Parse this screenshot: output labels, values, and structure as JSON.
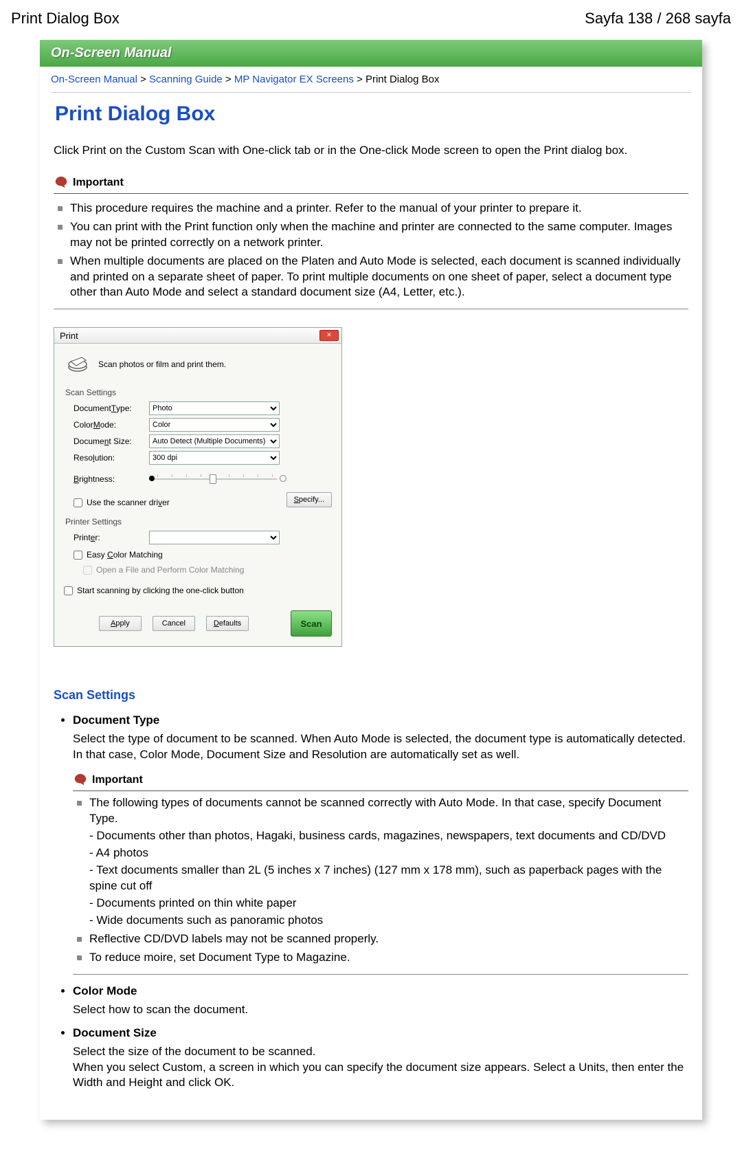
{
  "header": {
    "left": "Print Dialog Box",
    "right": "Sayfa 138 / 268 sayfa"
  },
  "banner": "On-Screen Manual",
  "crumbs": {
    "a": "On-Screen Manual",
    "b": "Scanning Guide",
    "c": "MP Navigator EX Screens",
    "current": "Print Dialog Box",
    "sep": " > "
  },
  "title": "Print Dialog Box",
  "intro": "Click Print on the Custom Scan with One-click tab or in the One-click Mode screen to open the Print dialog box.",
  "important_label": "Important",
  "important1": [
    "This procedure requires the machine and a printer. Refer to the manual of your printer to prepare it.",
    "You can print with the Print function only when the machine and printer are connected to the same computer. Images may not be printed correctly on a network printer.",
    "When multiple documents are placed on the Platen and Auto Mode is selected, each document is scanned individually and printed on a separate sheet of paper. To print multiple documents on one sheet of paper, select a document type other than Auto Mode and select a standard document size (A4, Letter, etc.)."
  ],
  "dlg": {
    "title": "Print",
    "close_glyph": "✕",
    "head_text": "Scan photos or film and print them.",
    "scan_settings": "Scan Settings",
    "printer_settings": "Printer Settings",
    "labels": {
      "doc_type_pre": "Document ",
      "doc_type_u": "T",
      "doc_type_post": "ype:",
      "color_pre": "Color ",
      "color_u": "M",
      "color_post": "ode:",
      "size_pre": "Docume",
      "size_u": "n",
      "size_post": "t Size:",
      "res_pre": "Reso",
      "res_u": "l",
      "res_post": "ution:",
      "bri_u": "B",
      "bri_post": "rightness:",
      "printer_pre": "Print",
      "printer_u": "e",
      "printer_post": "r:"
    },
    "values": {
      "doc_type": "Photo",
      "color": "Color",
      "size": "Auto Detect (Multiple Documents)",
      "res": "300 dpi",
      "printer": ""
    },
    "use_driver_pre": "Use the scanner dri",
    "use_driver_u": "v",
    "use_driver_post": "er",
    "specify_u": "S",
    "specify_post": "pecify...",
    "easy_color_pre": "Easy ",
    "easy_color_u": "C",
    "easy_color_post": "olor Matching",
    "open_file": "Open a File and Perform Color Matching",
    "one_click": "Start scanning by clicking the one-click button",
    "btn_apply_u": "A",
    "btn_apply_post": "pply",
    "btn_cancel": "Cancel",
    "btn_defaults_u": "D",
    "btn_defaults_post": "efaults",
    "btn_scan": "Scan"
  },
  "scan_settings_heading": "Scan Settings",
  "items": {
    "doc_type": {
      "title": "Document Type",
      "body": "Select the type of document to be scanned. When Auto Mode is selected, the document type is automatically detected. In that case, Color Mode, Document Size and Resolution are automatically set as well."
    },
    "color_mode": {
      "title": "Color Mode",
      "body": "Select how to scan the document."
    },
    "doc_size": {
      "title": "Document Size",
      "body1": "Select the size of the document to be scanned.",
      "body2": "When you select Custom, a screen in which you can specify the document size appears. Select a Units, then enter the Width and Height and click OK."
    }
  },
  "important2": {
    "bullet1_line1": "The following types of documents cannot be scanned correctly with Auto Mode. In that case, specify Document Type.",
    "bullet1_sub": [
      "- Documents other than photos, Hagaki, business cards, magazines, newspapers, text documents and CD/DVD",
      "- A4 photos",
      "- Text documents smaller than 2L (5 inches x 7 inches) (127 mm x 178 mm), such as paperback pages with the spine cut off",
      "- Documents printed on thin white paper",
      "- Wide documents such as panoramic photos"
    ],
    "bullet2": "Reflective CD/DVD labels may not be scanned properly.",
    "bullet3": "To reduce moire, set Document Type to Magazine."
  }
}
